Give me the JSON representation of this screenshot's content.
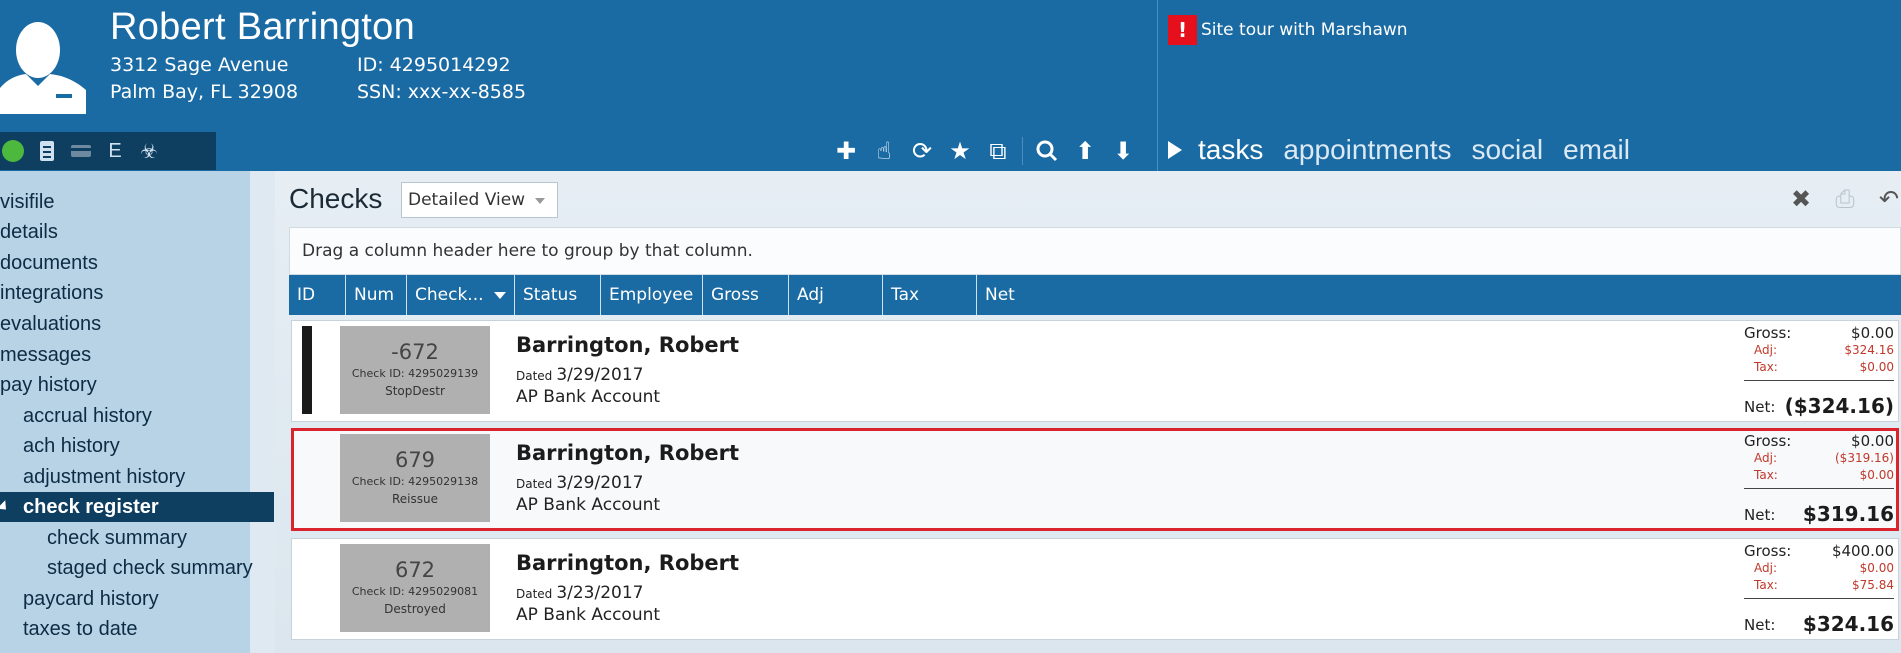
{
  "employee": {
    "name": "Robert Barrington",
    "address_line1": "3312 Sage Avenue",
    "address_line2": "Palm Bay, FL 32908",
    "id_label": "ID: 4295014292",
    "ssn_label": "SSN: xxx-xx-8585"
  },
  "tour": {
    "alert_icon": "!",
    "text": "Site tour with Marshawn"
  },
  "status_strip": {
    "e_label": "E",
    "v_label": "☣"
  },
  "tasknav": {
    "items": [
      "tasks",
      "appointments",
      "social",
      "email"
    ]
  },
  "sidebar": {
    "items": [
      {
        "label": "visifile"
      },
      {
        "label": "details"
      },
      {
        "label": "documents"
      },
      {
        "label": "integrations"
      },
      {
        "label": "evaluations"
      },
      {
        "label": "messages"
      },
      {
        "label": "pay history"
      },
      {
        "label": "accrual history"
      },
      {
        "label": "ach history"
      },
      {
        "label": "adjustment history"
      },
      {
        "label": "check register"
      },
      {
        "label": "check summary"
      },
      {
        "label": "staged check summary"
      },
      {
        "label": "paycard history"
      },
      {
        "label": "taxes to date"
      }
    ]
  },
  "main": {
    "title": "Checks",
    "view_select": "Detailed View",
    "group_hint": "Drag a column header here to group by that column.",
    "columns": [
      "ID",
      "Num",
      "Check...",
      "Status",
      "Employee",
      "Gross",
      "Adj",
      "Tax",
      "Net"
    ]
  },
  "rows": [
    {
      "check_num": "-672",
      "check_id": "Check ID: 4295029139",
      "status": "StopDestr",
      "employee": "Barrington, Robert",
      "dated_label": "Dated",
      "date": "3/29/2017",
      "account": "AP Bank Account",
      "gross_label": "Gross:",
      "gross": "$0.00",
      "adj_label": "Adj:",
      "adj": "$324.16",
      "tax_label": "Tax:",
      "tax": "$0.00",
      "net_label": "Net:",
      "net": "($324.16)"
    },
    {
      "check_num": "679",
      "check_id": "Check ID: 4295029138",
      "status": "Reissue",
      "employee": "Barrington, Robert",
      "dated_label": "Dated",
      "date": "3/29/2017",
      "account": "AP Bank Account",
      "gross_label": "Gross:",
      "gross": "$0.00",
      "adj_label": "Adj:",
      "adj": "($319.16)",
      "tax_label": "Tax:",
      "tax": "$0.00",
      "net_label": "Net:",
      "net": "$319.16"
    },
    {
      "check_num": "672",
      "check_id": "Check ID: 4295029081",
      "status": "Destroyed",
      "employee": "Barrington, Robert",
      "dated_label": "Dated",
      "date": "3/23/2017",
      "account": "AP Bank Account",
      "gross_label": "Gross:",
      "gross": "$400.00",
      "adj_label": "Adj:",
      "adj": "$0.00",
      "tax_label": "Tax:",
      "tax": "$75.84",
      "net_label": "Net:",
      "net": "$324.16"
    }
  ],
  "colors": {
    "header_blue": "#1a6aa3",
    "dark_navy": "#0e3e60",
    "sidebar": "#b8d3e5",
    "alert_red": "#e5101b",
    "selected_border": "#d9232d"
  }
}
